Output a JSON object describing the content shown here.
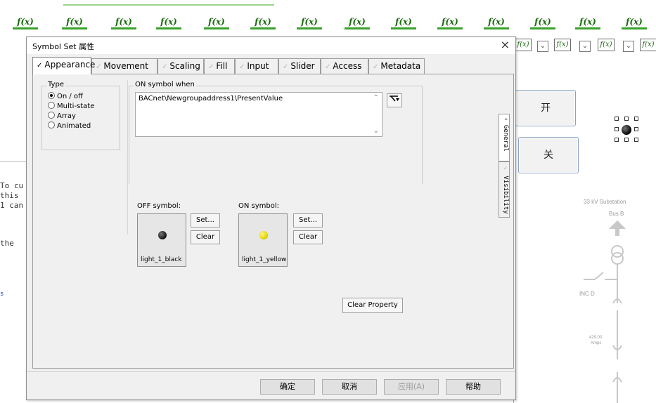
{
  "background": {
    "fx_labels": [
      "f(x)",
      "f(x)",
      "f(x)",
      "f(x)",
      "f(x)",
      "f(x)",
      "f(x)",
      "f(x)",
      "f(x)",
      "f(x)",
      "f(x)",
      "f(x)",
      "f(x)",
      "f(x)",
      "f(x)"
    ],
    "btn_open": "开",
    "btn_close": "关",
    "substation_label": "33 kV Substation",
    "bus_label": "Bus B",
    "inc_label": "INC D",
    "amps_label": "Amps",
    "amps_value": "429.00",
    "left_code_lines": [
      "To cu",
      " this",
      "1 can",
      "",
      " the"
    ],
    "left_link": "s"
  },
  "dialog": {
    "title": "Symbol Set 属性",
    "close_label": "×",
    "tabs": [
      {
        "label": "Appearance",
        "active": true
      },
      {
        "label": "Movement",
        "active": false
      },
      {
        "label": "Scaling",
        "active": false
      },
      {
        "label": "Fill",
        "active": false
      },
      {
        "label": "Input",
        "active": false
      },
      {
        "label": "Slider",
        "active": false
      },
      {
        "label": "Access",
        "active": false
      },
      {
        "label": "Metadata",
        "active": false
      }
    ],
    "type_group": {
      "label": "Type",
      "options": [
        {
          "label": "On / off",
          "selected": true
        },
        {
          "label": "Multi-state",
          "selected": false
        },
        {
          "label": "Array",
          "selected": false
        },
        {
          "label": "Animated",
          "selected": false
        }
      ]
    },
    "on_when": {
      "label": "ON symbol when",
      "value": "BACnet\\Newgroupaddress1\\PresentValue"
    },
    "off_symbol": {
      "label": "OFF symbol:",
      "name": "light_1_black",
      "color": "#111111"
    },
    "on_symbol": {
      "label": "ON symbol:",
      "name": "light_1_yellow",
      "color": "#e5d800"
    },
    "set_label": "Set...",
    "clear_label": "Clear",
    "clear_property_label": "Clear Property",
    "side_tabs": [
      {
        "label": "General",
        "active": true
      },
      {
        "label": "Visibility",
        "active": false
      }
    ],
    "footer": {
      "ok": "确定",
      "cancel": "取消",
      "apply": "应用(A)",
      "help": "帮助"
    }
  }
}
